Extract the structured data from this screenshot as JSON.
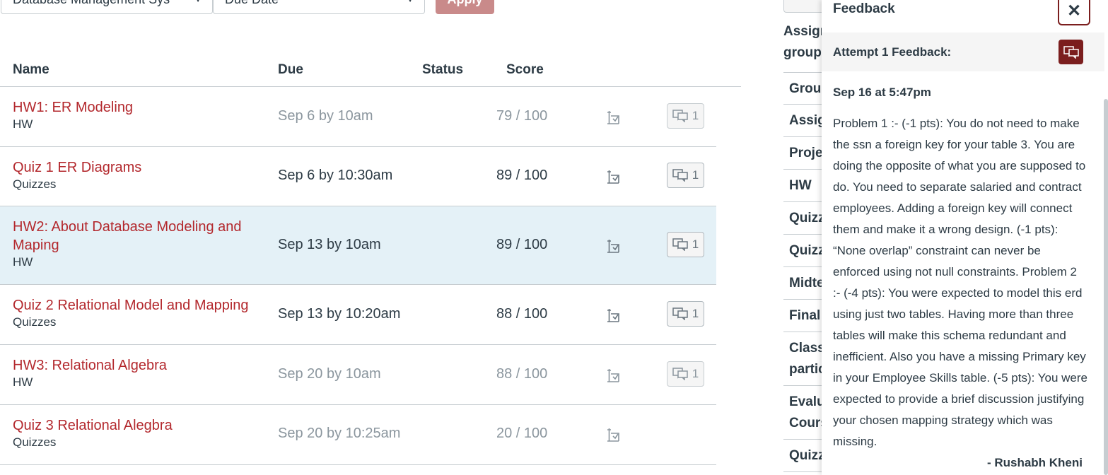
{
  "filters": {
    "course_select": "Database Management Sys",
    "sort_select": "Due Date",
    "apply_label": "Apply"
  },
  "table": {
    "headers": {
      "name": "Name",
      "due": "Due",
      "status": "Status",
      "score": "Score"
    },
    "rows": [
      {
        "name": "HW1: ER Modeling",
        "group": "HW",
        "due": "Sep 6 by 10am",
        "score": "79 / 100",
        "comments": "1"
      },
      {
        "name": "Quiz 1 ER Diagrams",
        "group": "Quizzes",
        "due": "Sep 6 by 10:30am",
        "score": "89 / 100",
        "comments": "1"
      },
      {
        "name": "HW2: About Database Modeling and Maping",
        "group": "HW",
        "due": "Sep 13 by 10am",
        "score": "89 / 100",
        "comments": "1"
      },
      {
        "name": "Quiz 2 Relational Model and Mapping",
        "group": "Quizzes",
        "due": "Sep 13 by 10:20am",
        "score": "88 / 100",
        "comments": "1"
      },
      {
        "name": "HW3: Relational Algebra",
        "group": "HW",
        "due": "Sep 20 by 10am",
        "score": "88 / 100",
        "comments": "1"
      },
      {
        "name": "Quiz 3 Relational Alegbra",
        "group": "Quizzes",
        "due": "Sep 20 by 10:25am",
        "score": "20 / 100",
        "comments": ""
      }
    ]
  },
  "side": {
    "title_line1": "Assigr",
    "title_line2": "groups",
    "items": [
      "Group",
      "Assig",
      "Proje",
      "HW",
      "Quizz",
      "Quizz",
      "Midte",
      "Final",
      "Class",
      "partic",
      "Evalu",
      "Cours",
      "Quizz"
    ]
  },
  "feedback": {
    "title": "Feedback",
    "close": "✕",
    "attempt_label": "Attempt 1 Feedback:",
    "date": "Sep 16 at 5:47pm",
    "text": "Problem 1 :- (-1 pts): You do not need to make the ssn a foreign key for your table 3. You are doing the opposite of what you are supposed to do. You need to separate salaried and contract employees. Adding a foreign key will connect them and make it a wrong design. (-1 pts): “None overlap” constraint can never be enforced using not null constraints. Problem 2 :- (-4 pts): You were expected to model this erd using just two tables. Having more than three tables will make this schema redundant and inefficient. Also you have a missing Primary key in your Employee Skills table. (-5 pts): You were expected to provide a brief discussion justifying your chosen mapping strategy which was missing.",
    "author": "- Rushabh Kheni"
  },
  "colors": {
    "link": "#b3282d",
    "brand": "#7b1e1e",
    "highlight": "#e4f1f7"
  },
  "icons": {
    "what_if": "what-if-calc-icon",
    "comment": "comment-bubbles-icon",
    "close": "close-icon"
  }
}
